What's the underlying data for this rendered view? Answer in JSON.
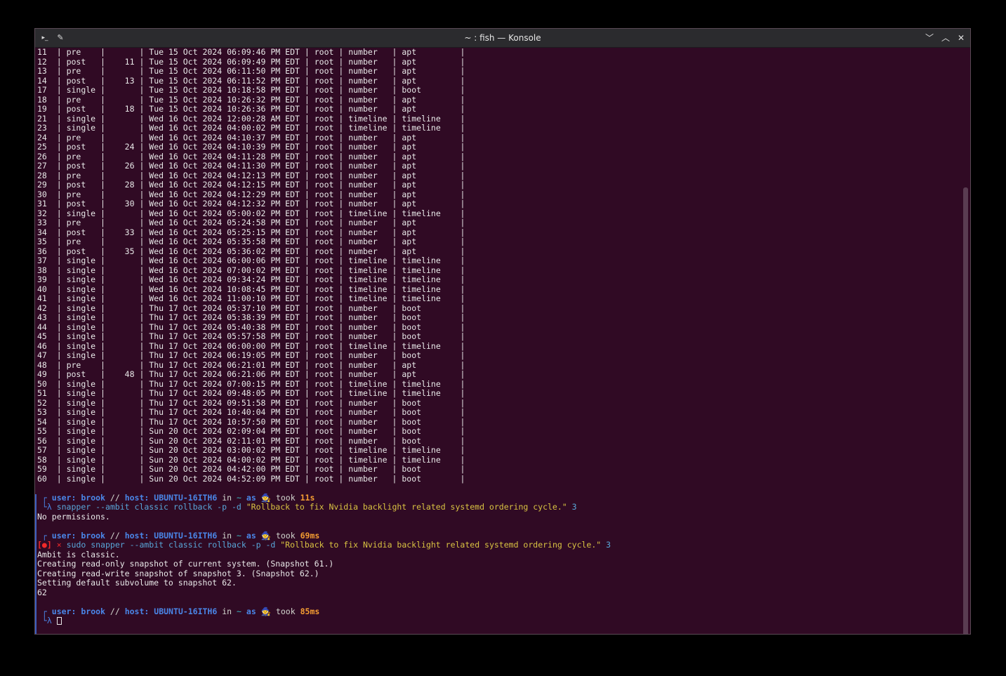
{
  "window": {
    "title": "~ : fish — Konsole",
    "icons": {
      "app": "terminal-icon",
      "pin": "pin-icon",
      "minimize": "chevron-down-icon",
      "maximize": "chevron-up-icon",
      "close": "close-icon"
    }
  },
  "colors": {
    "terminal_bg": "#300a24",
    "titlebar_bg": "#2b2b2e",
    "prompt_blue": "#4a86e8",
    "duration_orange": "#f39c32",
    "command_cyan": "#58a6d8",
    "string_yellow": "#d9c342",
    "error_red": "#ef2929"
  },
  "snapshots": [
    {
      "id": "11",
      "type": "pre",
      "pre": "",
      "date": "Tue 15 Oct 2024 06:09:46 PM EDT",
      "user": "root",
      "cleanup": "number",
      "description": "apt"
    },
    {
      "id": "12",
      "type": "post",
      "pre": "11",
      "date": "Tue 15 Oct 2024 06:09:49 PM EDT",
      "user": "root",
      "cleanup": "number",
      "description": "apt"
    },
    {
      "id": "13",
      "type": "pre",
      "pre": "",
      "date": "Tue 15 Oct 2024 06:11:50 PM EDT",
      "user": "root",
      "cleanup": "number",
      "description": "apt"
    },
    {
      "id": "14",
      "type": "post",
      "pre": "13",
      "date": "Tue 15 Oct 2024 06:11:52 PM EDT",
      "user": "root",
      "cleanup": "number",
      "description": "apt"
    },
    {
      "id": "17",
      "type": "single",
      "pre": "",
      "date": "Tue 15 Oct 2024 10:18:58 PM EDT",
      "user": "root",
      "cleanup": "number",
      "description": "boot"
    },
    {
      "id": "18",
      "type": "pre",
      "pre": "",
      "date": "Tue 15 Oct 2024 10:26:32 PM EDT",
      "user": "root",
      "cleanup": "number",
      "description": "apt"
    },
    {
      "id": "19",
      "type": "post",
      "pre": "18",
      "date": "Tue 15 Oct 2024 10:26:36 PM EDT",
      "user": "root",
      "cleanup": "number",
      "description": "apt"
    },
    {
      "id": "21",
      "type": "single",
      "pre": "",
      "date": "Wed 16 Oct 2024 12:00:28 AM EDT",
      "user": "root",
      "cleanup": "timeline",
      "description": "timeline"
    },
    {
      "id": "23",
      "type": "single",
      "pre": "",
      "date": "Wed 16 Oct 2024 04:00:02 PM EDT",
      "user": "root",
      "cleanup": "timeline",
      "description": "timeline"
    },
    {
      "id": "24",
      "type": "pre",
      "pre": "",
      "date": "Wed 16 Oct 2024 04:10:37 PM EDT",
      "user": "root",
      "cleanup": "number",
      "description": "apt"
    },
    {
      "id": "25",
      "type": "post",
      "pre": "24",
      "date": "Wed 16 Oct 2024 04:10:39 PM EDT",
      "user": "root",
      "cleanup": "number",
      "description": "apt"
    },
    {
      "id": "26",
      "type": "pre",
      "pre": "",
      "date": "Wed 16 Oct 2024 04:11:28 PM EDT",
      "user": "root",
      "cleanup": "number",
      "description": "apt"
    },
    {
      "id": "27",
      "type": "post",
      "pre": "26",
      "date": "Wed 16 Oct 2024 04:11:30 PM EDT",
      "user": "root",
      "cleanup": "number",
      "description": "apt"
    },
    {
      "id": "28",
      "type": "pre",
      "pre": "",
      "date": "Wed 16 Oct 2024 04:12:13 PM EDT",
      "user": "root",
      "cleanup": "number",
      "description": "apt"
    },
    {
      "id": "29",
      "type": "post",
      "pre": "28",
      "date": "Wed 16 Oct 2024 04:12:15 PM EDT",
      "user": "root",
      "cleanup": "number",
      "description": "apt"
    },
    {
      "id": "30",
      "type": "pre",
      "pre": "",
      "date": "Wed 16 Oct 2024 04:12:29 PM EDT",
      "user": "root",
      "cleanup": "number",
      "description": "apt"
    },
    {
      "id": "31",
      "type": "post",
      "pre": "30",
      "date": "Wed 16 Oct 2024 04:12:32 PM EDT",
      "user": "root",
      "cleanup": "number",
      "description": "apt"
    },
    {
      "id": "32",
      "type": "single",
      "pre": "",
      "date": "Wed 16 Oct 2024 05:00:02 PM EDT",
      "user": "root",
      "cleanup": "timeline",
      "description": "timeline"
    },
    {
      "id": "33",
      "type": "pre",
      "pre": "",
      "date": "Wed 16 Oct 2024 05:24:58 PM EDT",
      "user": "root",
      "cleanup": "number",
      "description": "apt"
    },
    {
      "id": "34",
      "type": "post",
      "pre": "33",
      "date": "Wed 16 Oct 2024 05:25:15 PM EDT",
      "user": "root",
      "cleanup": "number",
      "description": "apt"
    },
    {
      "id": "35",
      "type": "pre",
      "pre": "",
      "date": "Wed 16 Oct 2024 05:35:58 PM EDT",
      "user": "root",
      "cleanup": "number",
      "description": "apt"
    },
    {
      "id": "36",
      "type": "post",
      "pre": "35",
      "date": "Wed 16 Oct 2024 05:36:02 PM EDT",
      "user": "root",
      "cleanup": "number",
      "description": "apt"
    },
    {
      "id": "37",
      "type": "single",
      "pre": "",
      "date": "Wed 16 Oct 2024 06:00:06 PM EDT",
      "user": "root",
      "cleanup": "timeline",
      "description": "timeline"
    },
    {
      "id": "38",
      "type": "single",
      "pre": "",
      "date": "Wed 16 Oct 2024 07:00:02 PM EDT",
      "user": "root",
      "cleanup": "timeline",
      "description": "timeline"
    },
    {
      "id": "39",
      "type": "single",
      "pre": "",
      "date": "Wed 16 Oct 2024 09:34:24 PM EDT",
      "user": "root",
      "cleanup": "timeline",
      "description": "timeline"
    },
    {
      "id": "40",
      "type": "single",
      "pre": "",
      "date": "Wed 16 Oct 2024 10:08:45 PM EDT",
      "user": "root",
      "cleanup": "timeline",
      "description": "timeline"
    },
    {
      "id": "41",
      "type": "single",
      "pre": "",
      "date": "Wed 16 Oct 2024 11:00:10 PM EDT",
      "user": "root",
      "cleanup": "timeline",
      "description": "timeline"
    },
    {
      "id": "42",
      "type": "single",
      "pre": "",
      "date": "Thu 17 Oct 2024 05:37:10 PM EDT",
      "user": "root",
      "cleanup": "number",
      "description": "boot"
    },
    {
      "id": "43",
      "type": "single",
      "pre": "",
      "date": "Thu 17 Oct 2024 05:38:39 PM EDT",
      "user": "root",
      "cleanup": "number",
      "description": "boot"
    },
    {
      "id": "44",
      "type": "single",
      "pre": "",
      "date": "Thu 17 Oct 2024 05:40:38 PM EDT",
      "user": "root",
      "cleanup": "number",
      "description": "boot"
    },
    {
      "id": "45",
      "type": "single",
      "pre": "",
      "date": "Thu 17 Oct 2024 05:57:58 PM EDT",
      "user": "root",
      "cleanup": "number",
      "description": "boot"
    },
    {
      "id": "46",
      "type": "single",
      "pre": "",
      "date": "Thu 17 Oct 2024 06:00:00 PM EDT",
      "user": "root",
      "cleanup": "timeline",
      "description": "timeline"
    },
    {
      "id": "47",
      "type": "single",
      "pre": "",
      "date": "Thu 17 Oct 2024 06:19:05 PM EDT",
      "user": "root",
      "cleanup": "number",
      "description": "boot"
    },
    {
      "id": "48",
      "type": "pre",
      "pre": "",
      "date": "Thu 17 Oct 2024 06:21:01 PM EDT",
      "user": "root",
      "cleanup": "number",
      "description": "apt"
    },
    {
      "id": "49",
      "type": "post",
      "pre": "48",
      "date": "Thu 17 Oct 2024 06:21:06 PM EDT",
      "user": "root",
      "cleanup": "number",
      "description": "apt"
    },
    {
      "id": "50",
      "type": "single",
      "pre": "",
      "date": "Thu 17 Oct 2024 07:00:15 PM EDT",
      "user": "root",
      "cleanup": "timeline",
      "description": "timeline"
    },
    {
      "id": "51",
      "type": "single",
      "pre": "",
      "date": "Thu 17 Oct 2024 09:48:05 PM EDT",
      "user": "root",
      "cleanup": "timeline",
      "description": "timeline"
    },
    {
      "id": "52",
      "type": "single",
      "pre": "",
      "date": "Thu 17 Oct 2024 09:51:58 PM EDT",
      "user": "root",
      "cleanup": "number",
      "description": "boot"
    },
    {
      "id": "53",
      "type": "single",
      "pre": "",
      "date": "Thu 17 Oct 2024 10:40:04 PM EDT",
      "user": "root",
      "cleanup": "number",
      "description": "boot"
    },
    {
      "id": "54",
      "type": "single",
      "pre": "",
      "date": "Thu 17 Oct 2024 10:57:50 PM EDT",
      "user": "root",
      "cleanup": "number",
      "description": "boot"
    },
    {
      "id": "55",
      "type": "single",
      "pre": "",
      "date": "Sun 20 Oct 2024 02:09:04 PM EDT",
      "user": "root",
      "cleanup": "number",
      "description": "boot"
    },
    {
      "id": "56",
      "type": "single",
      "pre": "",
      "date": "Sun 20 Oct 2024 02:11:01 PM EDT",
      "user": "root",
      "cleanup": "number",
      "description": "boot"
    },
    {
      "id": "57",
      "type": "single",
      "pre": "",
      "date": "Sun 20 Oct 2024 03:00:02 PM EDT",
      "user": "root",
      "cleanup": "timeline",
      "description": "timeline"
    },
    {
      "id": "58",
      "type": "single",
      "pre": "",
      "date": "Sun 20 Oct 2024 04:00:02 PM EDT",
      "user": "root",
      "cleanup": "timeline",
      "description": "timeline"
    },
    {
      "id": "59",
      "type": "single",
      "pre": "",
      "date": "Sun 20 Oct 2024 04:42:00 PM EDT",
      "user": "root",
      "cleanup": "number",
      "description": "boot"
    },
    {
      "id": "60",
      "type": "single",
      "pre": "",
      "date": "Sun 20 Oct 2024 04:52:09 PM EDT",
      "user": "root",
      "cleanup": "number",
      "description": "boot"
    }
  ],
  "prompt_labels": {
    "user_label": "user:",
    "user": "brook",
    "sep": "//",
    "host_label": "host:",
    "host": "UBUNTU-16ITH6",
    "in": "in",
    "dir": "~",
    "as": "as",
    "as_icon": "🧙",
    "took": "took",
    "corner_top": "┌",
    "corner_bottom": "└λ",
    "error_badge": "[●]",
    "error_mark": "×"
  },
  "blocks": [
    {
      "took": "11s",
      "error": false,
      "cmd": "snapper --ambit classic rollback -p -d",
      "arg": "\"Rollback to fix Nvidia backlight related systemd ordering cycle.\"",
      "num": "3",
      "output": [
        "No permissions."
      ]
    },
    {
      "took": "69ms",
      "error": true,
      "cmd": "sudo snapper --ambit classic rollback -p -d",
      "arg": "\"Rollback to fix Nvidia backlight related systemd ordering cycle.\"",
      "num": "3",
      "output": [
        "Ambit is classic.",
        "Creating read-only snapshot of current system. (Snapshot 61.)",
        "Creating read-write snapshot of snapshot 3. (Snapshot 62.)",
        "Setting default subvolume to snapshot 62.",
        "62"
      ]
    }
  ],
  "final_prompt": {
    "took": "85ms"
  }
}
